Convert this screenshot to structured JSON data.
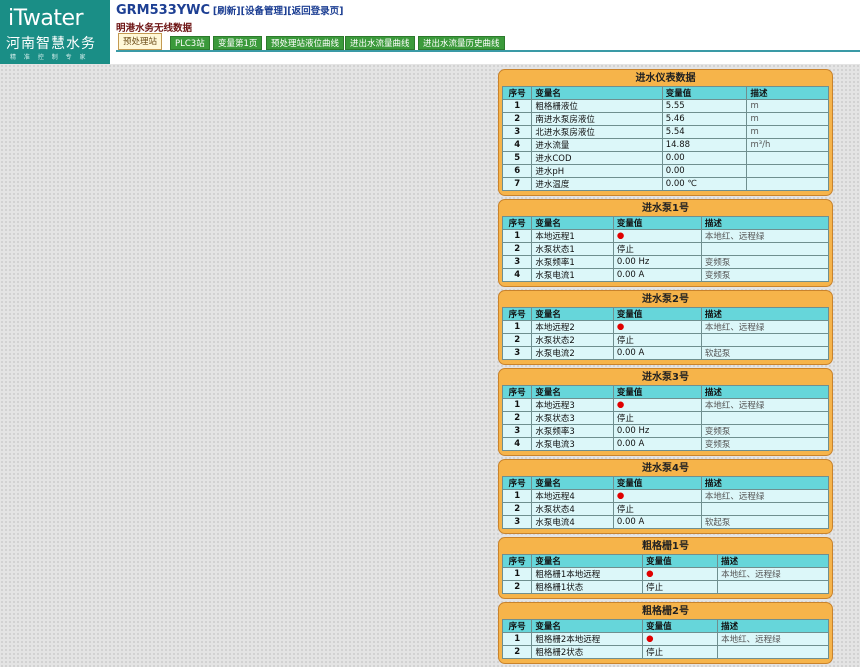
{
  "header": {
    "logo_main": "iTwater",
    "logo_cn": "河南智慧水务",
    "logo_slogan": "精 准 控 制 专 家",
    "device_name": "GRM533YWC",
    "links": [
      "[刷新]",
      "[设备管理]",
      "[返回登录页]"
    ],
    "subtitle": "明港水务无线数据"
  },
  "tabs": [
    "预处理站",
    "PLC3站",
    "变量第1页",
    "预处理站液位曲线",
    "进出水流量曲线",
    "进出水流量历史曲线"
  ],
  "panels": [
    {
      "title": "进水仪表数据",
      "headers": [
        "序号",
        "变量名",
        "变量值",
        "描述"
      ],
      "rows": [
        [
          "1",
          "粗格栅液位",
          "5.55",
          "m"
        ],
        [
          "2",
          "南进水泵房液位",
          "5.46",
          "m"
        ],
        [
          "3",
          "北进水泵房液位",
          "5.54",
          "m"
        ],
        [
          "4",
          "进水流量",
          "14.88",
          "m³/h"
        ],
        [
          "5",
          "进水COD",
          "0.00",
          ""
        ],
        [
          "6",
          "进水pH",
          "0.00",
          ""
        ],
        [
          "7",
          "进水温度",
          "0.00 ℃",
          ""
        ]
      ]
    },
    {
      "title": "进水泵1号",
      "headers": [
        "序号",
        "变量名",
        "变量值",
        "描述"
      ],
      "rows": [
        [
          "1",
          "本地远程1",
          "●",
          "本地红、远程绿"
        ],
        [
          "2",
          "水泵状态1",
          "停止",
          ""
        ],
        [
          "3",
          "水泵频率1",
          "0.00 Hz",
          "变频泵"
        ],
        [
          "4",
          "水泵电流1",
          "0.00 A",
          "变频泵"
        ]
      ]
    },
    {
      "title": "进水泵2号",
      "headers": [
        "序号",
        "变量名",
        "变量值",
        "描述"
      ],
      "rows": [
        [
          "1",
          "本地远程2",
          "●",
          "本地红、远程绿"
        ],
        [
          "2",
          "水泵状态2",
          "停止",
          ""
        ],
        [
          "3",
          "水泵电流2",
          "0.00 A",
          "软起泵"
        ]
      ]
    },
    {
      "title": "进水泵3号",
      "headers": [
        "序号",
        "变量名",
        "变量值",
        "描述"
      ],
      "rows": [
        [
          "1",
          "本地远程3",
          "●",
          "本地红、远程绿"
        ],
        [
          "2",
          "水泵状态3",
          "停止",
          ""
        ],
        [
          "3",
          "水泵频率3",
          "0.00 Hz",
          "变频泵"
        ],
        [
          "4",
          "水泵电流3",
          "0.00 A",
          "变频泵"
        ]
      ]
    },
    {
      "title": "进水泵4号",
      "headers": [
        "序号",
        "变量名",
        "变量值",
        "描述"
      ],
      "rows": [
        [
          "1",
          "本地远程4",
          "●",
          "本地红、远程绿"
        ],
        [
          "2",
          "水泵状态4",
          "停止",
          ""
        ],
        [
          "3",
          "水泵电流4",
          "0.00 A",
          "软起泵"
        ]
      ]
    },
    {
      "title": "粗格栅1号",
      "headers": [
        "序号",
        "变量名",
        "变量值",
        "描述"
      ],
      "rows": [
        [
          "1",
          "粗格栅1本地远程",
          "●",
          "本地红、远程绿"
        ],
        [
          "2",
          "粗格栅1状态",
          "停止",
          ""
        ]
      ]
    },
    {
      "title": "粗格栅2号",
      "headers": [
        "序号",
        "变量名",
        "变量值",
        "描述"
      ],
      "rows": [
        [
          "1",
          "粗格栅2本地远程",
          "●",
          "本地红、远程绿"
        ],
        [
          "2",
          "粗格栅2状态",
          "停止",
          ""
        ]
      ]
    }
  ]
}
